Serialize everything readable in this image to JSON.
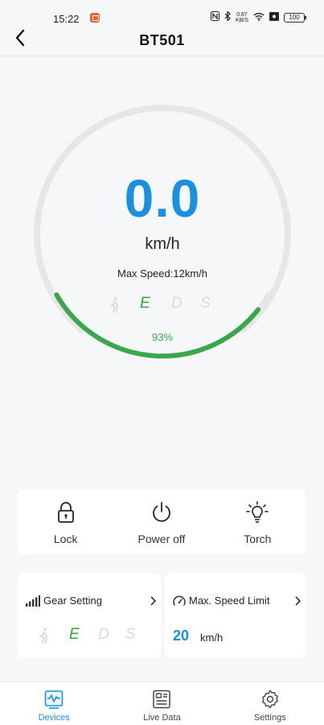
{
  "status_bar": {
    "time": "15:22",
    "net_speed_value": "0.87",
    "net_speed_unit": "KB/S",
    "battery": "100"
  },
  "header": {
    "title": "BT501"
  },
  "dashboard": {
    "speed": "0.0",
    "speed_unit": "km/h",
    "max_speed_text": "Max Speed:12km/h",
    "battery_percent_text": "93%",
    "battery_level": 0.93,
    "gears": [
      "E",
      "D",
      "S"
    ],
    "active_gear": "E"
  },
  "actions": [
    {
      "label": "Lock",
      "icon": "lock-icon"
    },
    {
      "label": "Power off",
      "icon": "power-icon"
    },
    {
      "label": "Torch",
      "icon": "torch-icon"
    }
  ],
  "gear_setting": {
    "title": "Gear Setting",
    "gears": [
      "E",
      "D",
      "S"
    ],
    "active_gear": "E"
  },
  "speed_limit": {
    "title": "Max. Speed Limit",
    "value": "20",
    "unit": "km/h"
  },
  "bottom_nav": [
    {
      "label": "Devices",
      "icon": "devices-icon",
      "active": true
    },
    {
      "label": "Live Data",
      "icon": "live-data-icon",
      "active": false
    },
    {
      "label": "Settings",
      "icon": "settings-icon",
      "active": false
    }
  ],
  "colors": {
    "accent": "#1b8fe0",
    "gear_active": "#2eaa3a",
    "gear_inactive": "#d9dbde",
    "gauge_track": "#e6e6e6",
    "battery_bar": "#3aa84a"
  }
}
